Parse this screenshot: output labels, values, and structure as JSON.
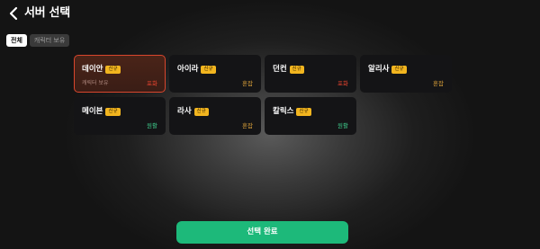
{
  "header": {
    "title": "서버 선택"
  },
  "filters": [
    {
      "label": "전체",
      "active": true
    },
    {
      "label": "캐릭터 보유",
      "active": false
    }
  ],
  "servers": [
    {
      "name": "데이안",
      "badge": "신규",
      "sub": "캐릭터 보유",
      "status": "포화",
      "selected": true
    },
    {
      "name": "아이라",
      "badge": "신규",
      "sub": "",
      "status": "혼잡",
      "selected": false
    },
    {
      "name": "던컨",
      "badge": "신규",
      "sub": "",
      "status": "포화",
      "selected": false
    },
    {
      "name": "알리사",
      "badge": "신규",
      "sub": "",
      "status": "혼잡",
      "selected": false
    },
    {
      "name": "메이븐",
      "badge": "신규",
      "sub": "",
      "status": "원활",
      "selected": false
    },
    {
      "name": "라사",
      "badge": "신규",
      "sub": "",
      "status": "혼잡",
      "selected": false
    },
    {
      "name": "칼릭스",
      "badge": "신규",
      "sub": "",
      "status": "원활",
      "selected": false
    }
  ],
  "confirm_button": {
    "label": "선택 완료"
  },
  "colors": {
    "confirm": "#1db97a",
    "selected_border": "#d9462d",
    "badge": "#f2b51f",
    "status_full": "#e8442f",
    "status_crowded": "#e0a43a",
    "status_smooth": "#3ec98a"
  },
  "icons": {
    "back": "chevron-left-icon"
  }
}
